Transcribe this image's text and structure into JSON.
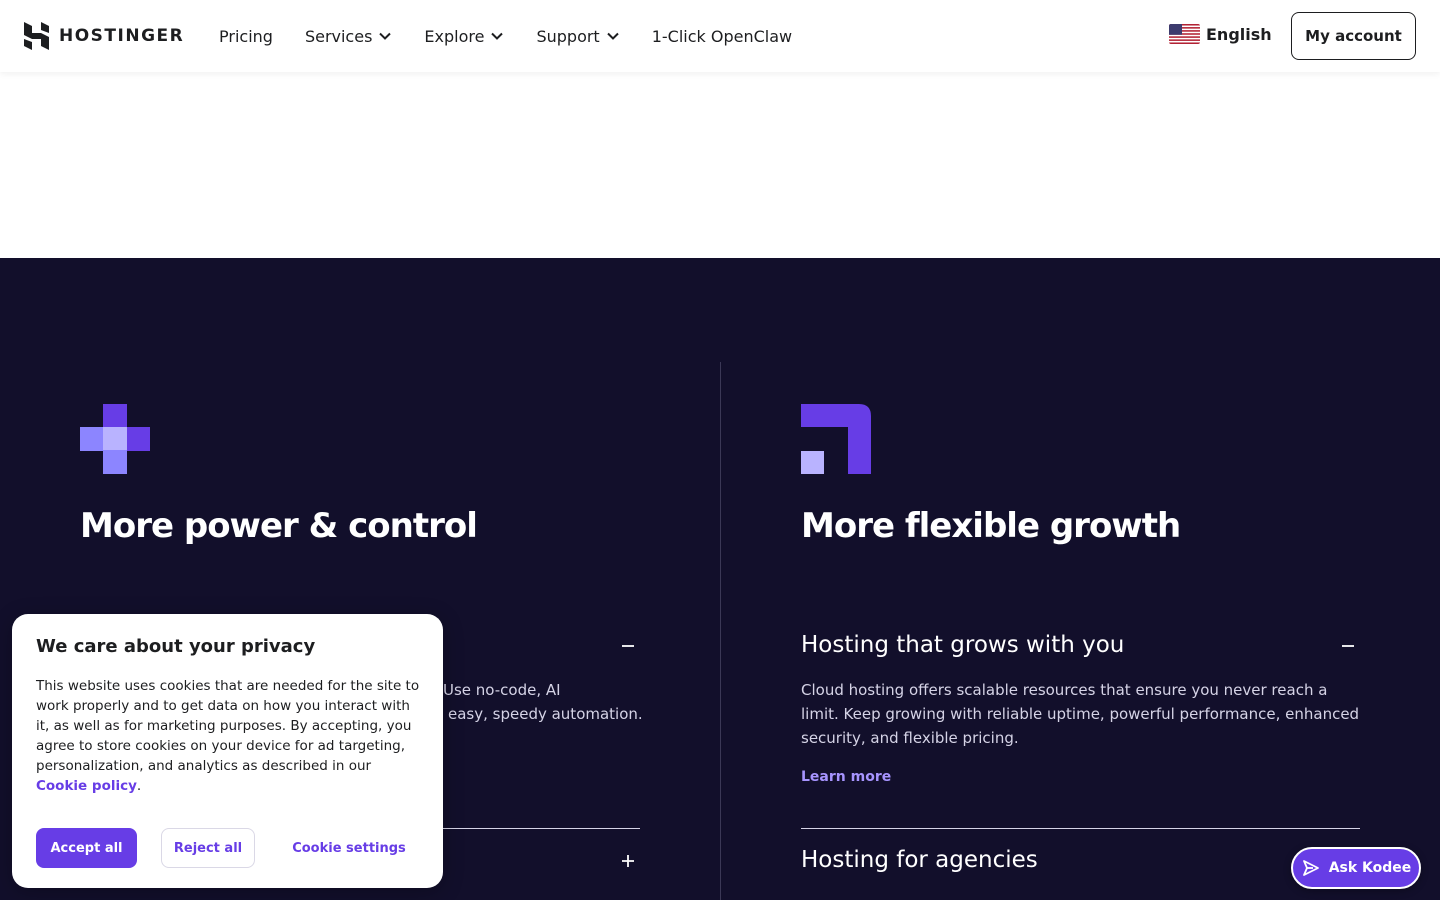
{
  "header": {
    "logo_text": "HOSTINGER",
    "nav": [
      {
        "label": "Pricing",
        "has_dropdown": false
      },
      {
        "label": "Services",
        "has_dropdown": true
      },
      {
        "label": "Explore",
        "has_dropdown": true
      },
      {
        "label": "Support",
        "has_dropdown": true
      },
      {
        "label": "1-Click OpenClaw",
        "has_dropdown": false
      }
    ],
    "language": "English",
    "account_button": "My account"
  },
  "features": {
    "left": {
      "icon": "plus-blocks-icon",
      "title": "More power & control",
      "accordion_1_text_line1": "Use no-code, AI",
      "accordion_1_text_line2": "easy, speedy automation."
    },
    "right": {
      "icon": "corner-blocks-icon",
      "title": "More flexible growth",
      "accordion_1_heading": "Hosting that grows with you",
      "accordion_1_text": "Cloud hosting offers scalable resources that ensure you never reach a limit. Keep growing with reliable uptime, powerful performance, enhanced security, and flexible pricing.",
      "accordion_1_link": "Learn more",
      "accordion_2_heading": "Hosting for agencies"
    }
  },
  "cookie_banner": {
    "title": "We care about your privacy",
    "text": "This website uses cookies that are needed for the site to work properly and to get data on how you interact with it, as well as for marketing purposes. By accepting, you agree to store cookies on your device for ad targeting, personalization, and analytics as described in our",
    "link_text": "Cookie policy",
    "link_suffix": ".",
    "accept": "Accept all",
    "reject": "Reject all",
    "settings": "Cookie settings"
  },
  "chat": {
    "label": "Ask Kodee"
  },
  "colors": {
    "brand": "#673de6",
    "brand_light": "#8c85ff",
    "dark_bg": "#120f2b",
    "link": "#a794ff"
  }
}
